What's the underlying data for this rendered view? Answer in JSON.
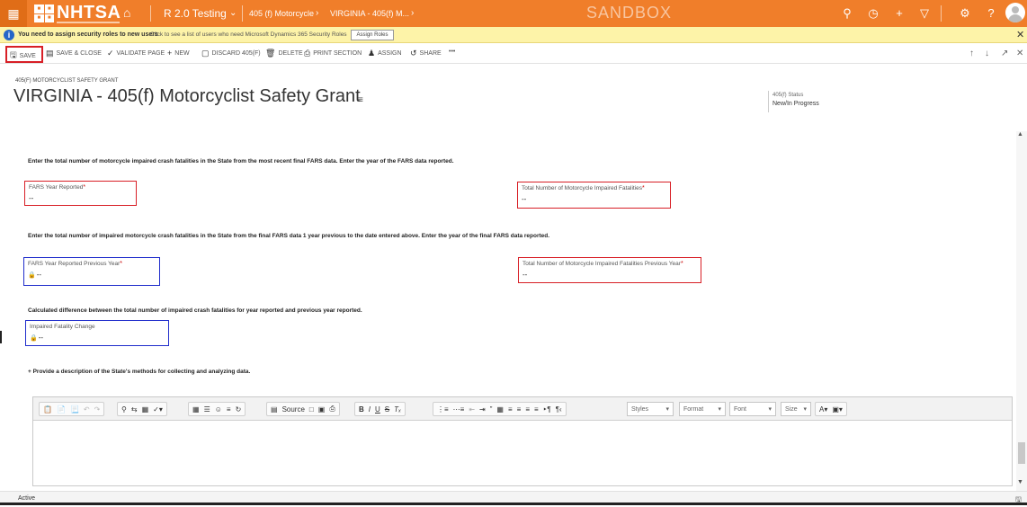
{
  "nav": {
    "brand": "NHTSA",
    "badge_letters": [
      "■",
      "■",
      "■",
      "■"
    ],
    "module": "R 2.0 Testing",
    "breadcrumbs": [
      "405 (f) Motorcycle",
      "VIRGINIA - 405(f) M..."
    ],
    "environment": "SANDBOX",
    "accent": "#f07e2a",
    "icons": [
      "search-icon",
      "history-icon",
      "plus-icon",
      "filter-icon",
      "gear-icon",
      "help-icon"
    ]
  },
  "notification": {
    "title": "You need to assign security roles to new users",
    "text": "Click to see a list of users who need Microsoft Dynamics 365 Security Roles",
    "button": "Assign Roles"
  },
  "commands": [
    {
      "label": "SAVE",
      "icon": "save-icon"
    },
    {
      "label": "SAVE & CLOSE",
      "icon": "save-close-icon"
    },
    {
      "label": "VALIDATE PAGE",
      "icon": "validate-icon"
    },
    {
      "label": "NEW",
      "icon": "new-icon"
    },
    {
      "label": "DISCARD 405(F)",
      "icon": "discard-icon"
    },
    {
      "label": "DELETE",
      "icon": "delete-icon"
    },
    {
      "label": "PRINT SECTION",
      "icon": "print-icon"
    },
    {
      "label": "ASSIGN",
      "icon": "assign-icon"
    },
    {
      "label": "SHARE",
      "icon": "share-icon"
    },
    {
      "label": "•••",
      "icon": "more-icon"
    }
  ],
  "header": {
    "entity": "405(F) MOTORCYCLIST SAFETY GRANT",
    "title": "VIRGINIA - 405(f) Motorcyclist Safety Grant",
    "status_label": "405(f) Status",
    "status_value": "New/In Progress"
  },
  "form": {
    "instructions": [
      "Enter the total number of motorcycle impaired crash fatalities in the State from the most recent final FARS data. Enter the year of the FARS data reported.",
      "Enter the total number of impaired motorcycle crash fatalities in the State from the final FARS data 1 year previous to the date entered above. Enter the year of the final FARS data reported.",
      "Calculated difference between the total number of impaired crash fatalities for year reported and previous year reported.",
      "+ Provide a description of the State's methods for collecting and analyzing data."
    ],
    "fields": {
      "fars_year": {
        "label": "FARS Year Reported",
        "value": "--"
      },
      "total_fatalities": {
        "label": "Total Number of Motorcycle Impaired Fatalities",
        "value": "--"
      },
      "fars_year_prev": {
        "label": "FARS Year Reported Previous Year",
        "value": "--"
      },
      "total_fatalities_prev": {
        "label": "Total Number of Motorcycle Impaired Fatalities Previous Year",
        "value": "--"
      },
      "fatality_change": {
        "label": "Impaired Fatality Change",
        "value": "--"
      }
    },
    "required_mark": "*"
  },
  "editor": {
    "source_label": "Source",
    "styles": "Styles",
    "format": "Format",
    "font": "Font",
    "size": "Size"
  },
  "status_bar": {
    "text": "Active"
  }
}
